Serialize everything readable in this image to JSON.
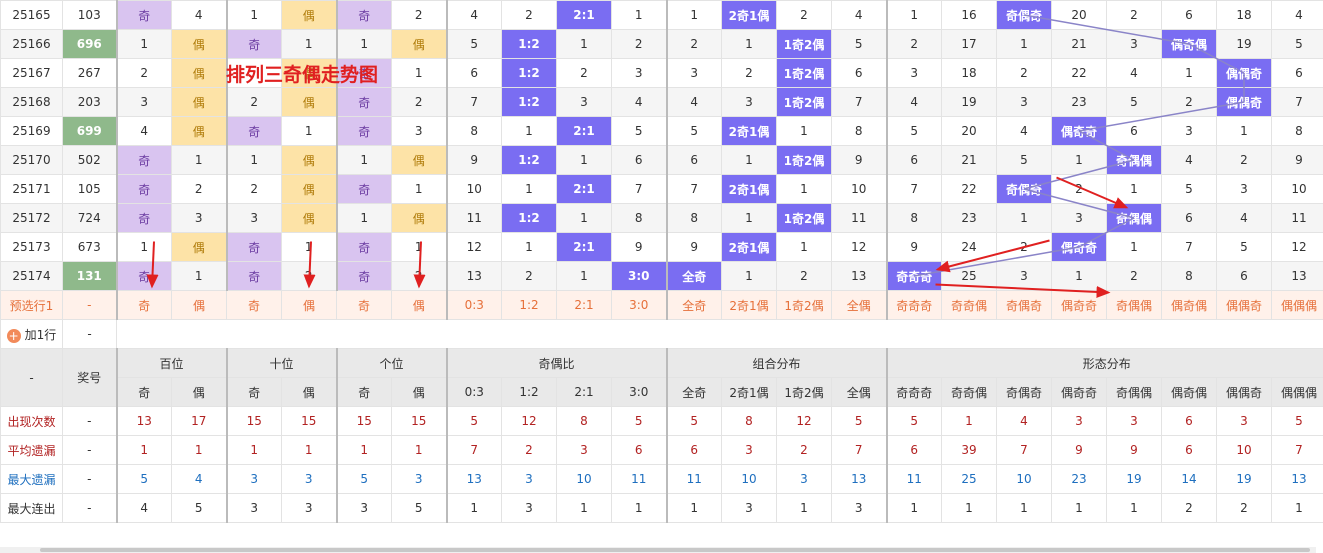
{
  "title": "排列三奇偶走势图",
  "odd": "奇",
  "even": "偶",
  "rows": [
    {
      "issue": "25165",
      "award": "103",
      "award_hl": false,
      "pos": [
        {
          "odd": true,
          "v": "奇"
        },
        {
          "odd": false,
          "v": "4"
        },
        {
          "odd": false,
          "v": "1"
        },
        {
          "even": true,
          "v": "偶"
        },
        {
          "odd": true,
          "v": "奇"
        },
        {
          "odd": false,
          "v": "2"
        }
      ],
      "ratio": [
        "4",
        "2",
        "2:1",
        "1"
      ],
      "ratio_hit": 2,
      "combo": [
        "1",
        "2奇1偶",
        "2",
        "4"
      ],
      "combo_hit": 1,
      "shape": [
        "1",
        "16",
        "奇偶奇",
        "20",
        "2",
        "6",
        "18",
        "4"
      ],
      "shape_hit": 2
    },
    {
      "issue": "25166",
      "award": "696",
      "award_hl": true,
      "pos": [
        {
          "v": "1"
        },
        {
          "even": true,
          "v": "偶"
        },
        {
          "odd": true,
          "v": "奇"
        },
        {
          "v": "1"
        },
        {
          "v": "1"
        },
        {
          "even": true,
          "v": "偶"
        }
      ],
      "ratio": [
        "5",
        "1:2",
        "1",
        "2"
      ],
      "ratio_hit": 1,
      "combo": [
        "2",
        "1",
        "1奇2偶",
        "5"
      ],
      "combo_hit": 2,
      "shape": [
        "2",
        "17",
        "1",
        "21",
        "3",
        "偶奇偶",
        "19",
        "5"
      ],
      "shape_hit": 5
    },
    {
      "issue": "25167",
      "award": "267",
      "award_hl": false,
      "pos": [
        {
          "v": "2"
        },
        {
          "even": true,
          "v": "偶"
        },
        {
          "v": ""
        },
        {
          "even": true,
          "v": "偶"
        },
        {
          "odd": true,
          "v": "奇"
        },
        {
          "v": "1"
        }
      ],
      "ratio": [
        "6",
        "1:2",
        "2",
        "3"
      ],
      "ratio_hit": 1,
      "combo": [
        "3",
        "2",
        "1奇2偶",
        "6"
      ],
      "combo_hit": 2,
      "shape": [
        "3",
        "18",
        "2",
        "22",
        "4",
        "1",
        "偶偶奇",
        "6"
      ],
      "shape_hit": 6
    },
    {
      "issue": "25168",
      "award": "203",
      "award_hl": false,
      "pos": [
        {
          "v": "3"
        },
        {
          "even": true,
          "v": "偶"
        },
        {
          "v": "2"
        },
        {
          "even": true,
          "v": "偶"
        },
        {
          "odd": true,
          "v": "奇"
        },
        {
          "v": "2"
        }
      ],
      "ratio": [
        "7",
        "1:2",
        "3",
        "4"
      ],
      "ratio_hit": 1,
      "combo": [
        "4",
        "3",
        "1奇2偶",
        "7"
      ],
      "combo_hit": 2,
      "shape": [
        "4",
        "19",
        "3",
        "23",
        "5",
        "2",
        "偶偶奇",
        "7"
      ],
      "shape_hit": 6
    },
    {
      "issue": "25169",
      "award": "699",
      "award_hl": true,
      "pos": [
        {
          "v": "4"
        },
        {
          "even": true,
          "v": "偶"
        },
        {
          "odd": true,
          "v": "奇"
        },
        {
          "v": "1"
        },
        {
          "odd": true,
          "v": "奇"
        },
        {
          "v": "3"
        }
      ],
      "ratio": [
        "8",
        "1",
        "2:1",
        "5"
      ],
      "ratio_hit": 2,
      "combo": [
        "5",
        "2奇1偶",
        "1",
        "8"
      ],
      "combo_hit": 1,
      "shape": [
        "5",
        "20",
        "4",
        "偶奇奇",
        "6",
        "3",
        "1",
        "8"
      ],
      "shape_hit": 3
    },
    {
      "issue": "25170",
      "award": "502",
      "award_hl": false,
      "pos": [
        {
          "odd": true,
          "v": "奇"
        },
        {
          "v": "1"
        },
        {
          "v": "1"
        },
        {
          "even": true,
          "v": "偶"
        },
        {
          "v": "1"
        },
        {
          "even": true,
          "v": "偶"
        }
      ],
      "ratio": [
        "9",
        "1:2",
        "1",
        "6"
      ],
      "ratio_hit": 1,
      "combo": [
        "6",
        "1",
        "1奇2偶",
        "9"
      ],
      "combo_hit": 2,
      "shape": [
        "6",
        "21",
        "5",
        "1",
        "奇偶偶",
        "4",
        "2",
        "9"
      ],
      "shape_hit": 4
    },
    {
      "issue": "25171",
      "award": "105",
      "award_hl": false,
      "pos": [
        {
          "odd": true,
          "v": "奇"
        },
        {
          "v": "2"
        },
        {
          "v": "2"
        },
        {
          "even": true,
          "v": "偶"
        },
        {
          "odd": true,
          "v": "奇"
        },
        {
          "v": "1"
        }
      ],
      "ratio": [
        "10",
        "1",
        "2:1",
        "7"
      ],
      "ratio_hit": 2,
      "combo": [
        "7",
        "2奇1偶",
        "1",
        "10"
      ],
      "combo_hit": 1,
      "shape": [
        "7",
        "22",
        "奇偶奇",
        "2",
        "1",
        "5",
        "3",
        "10"
      ],
      "shape_hit": 2
    },
    {
      "issue": "25172",
      "award": "724",
      "award_hl": false,
      "pos": [
        {
          "odd": true,
          "v": "奇"
        },
        {
          "v": "3"
        },
        {
          "v": "3"
        },
        {
          "even": true,
          "v": "偶"
        },
        {
          "v": "1"
        },
        {
          "even": true,
          "v": "偶"
        }
      ],
      "ratio": [
        "11",
        "1:2",
        "1",
        "8"
      ],
      "ratio_hit": 1,
      "combo": [
        "8",
        "1",
        "1奇2偶",
        "11"
      ],
      "combo_hit": 2,
      "shape": [
        "8",
        "23",
        "1",
        "3",
        "奇偶偶",
        "6",
        "4",
        "11"
      ],
      "shape_hit": 4
    },
    {
      "issue": "25173",
      "award": "673",
      "award_hl": false,
      "pos": [
        {
          "v": "1"
        },
        {
          "even": true,
          "v": "偶"
        },
        {
          "odd": true,
          "v": "奇"
        },
        {
          "v": "1"
        },
        {
          "odd": true,
          "v": "奇"
        },
        {
          "v": "1"
        }
      ],
      "ratio": [
        "12",
        "1",
        "2:1",
        "9"
      ],
      "ratio_hit": 2,
      "combo": [
        "9",
        "2奇1偶",
        "1",
        "12"
      ],
      "combo_hit": 1,
      "shape": [
        "9",
        "24",
        "2",
        "偶奇奇",
        "1",
        "7",
        "5",
        "12"
      ],
      "shape_hit": 3
    },
    {
      "issue": "25174",
      "award": "131",
      "award_hl": true,
      "pos": [
        {
          "odd": true,
          "v": "奇"
        },
        {
          "v": "1"
        },
        {
          "odd": true,
          "v": "奇"
        },
        {
          "v": "2"
        },
        {
          "odd": true,
          "v": "奇"
        },
        {
          "v": "2"
        }
      ],
      "ratio": [
        "13",
        "2",
        "1",
        "3:0"
      ],
      "ratio_hit": 3,
      "combo": [
        "全奇",
        "1",
        "2",
        "13"
      ],
      "combo_hit": 0,
      "shape": [
        "奇奇奇",
        "25",
        "3",
        "1",
        "2",
        "8",
        "6",
        "13"
      ],
      "shape_hit": 0
    }
  ],
  "preset": {
    "label": "预选行1",
    "dash": "-",
    "cells": [
      "奇",
      "偶",
      "奇",
      "偶",
      "奇",
      "偶",
      "0:3",
      "1:2",
      "2:1",
      "3:0",
      "全奇",
      "2奇1偶",
      "1奇2偶",
      "全偶",
      "奇奇奇",
      "奇奇偶",
      "奇偶奇",
      "偶奇奇",
      "奇偶偶",
      "偶奇偶",
      "偶偶奇",
      "偶偶偶"
    ]
  },
  "addrow": {
    "label": "加1行",
    "dash": "-"
  },
  "header": {
    "dash": "-",
    "award": "奖号",
    "groups": [
      "百位",
      "十位",
      "个位",
      "奇偶比",
      "组合分布",
      "形态分布"
    ],
    "sub": [
      "奇",
      "偶",
      "奇",
      "偶",
      "奇",
      "偶",
      "0:3",
      "1:2",
      "2:1",
      "3:0",
      "全奇",
      "2奇1偶",
      "1奇2偶",
      "全偶",
      "奇奇奇",
      "奇奇偶",
      "奇偶奇",
      "偶奇奇",
      "奇偶偶",
      "偶奇偶",
      "偶偶奇",
      "偶偶偶"
    ]
  },
  "stats": [
    {
      "name": "出现次数",
      "dash": "-",
      "values": [
        "13",
        "17",
        "15",
        "15",
        "15",
        "15",
        "5",
        "12",
        "8",
        "5",
        "5",
        "8",
        "12",
        "5",
        "5",
        "1",
        "4",
        "3",
        "3",
        "6",
        "3",
        "5"
      ]
    },
    {
      "name": "平均遗漏",
      "dash": "-",
      "values": [
        "1",
        "1",
        "1",
        "1",
        "1",
        "1",
        "7",
        "2",
        "3",
        "6",
        "6",
        "3",
        "2",
        "7",
        "6",
        "39",
        "7",
        "9",
        "9",
        "6",
        "10",
        "7"
      ]
    },
    {
      "name": "最大遗漏",
      "dash": "-",
      "values": [
        "5",
        "4",
        "3",
        "3",
        "5",
        "3",
        "13",
        "3",
        "10",
        "11",
        "11",
        "10",
        "3",
        "13",
        "11",
        "25",
        "10",
        "23",
        "19",
        "14",
        "19",
        "13"
      ]
    },
    {
      "name": "最大连出",
      "dash": "-",
      "values": [
        "4",
        "5",
        "3",
        "3",
        "3",
        "5",
        "1",
        "3",
        "1",
        "1",
        "1",
        "3",
        "1",
        "3",
        "1",
        "1",
        "1",
        "1",
        "1",
        "2",
        "2",
        "1"
      ]
    }
  ]
}
